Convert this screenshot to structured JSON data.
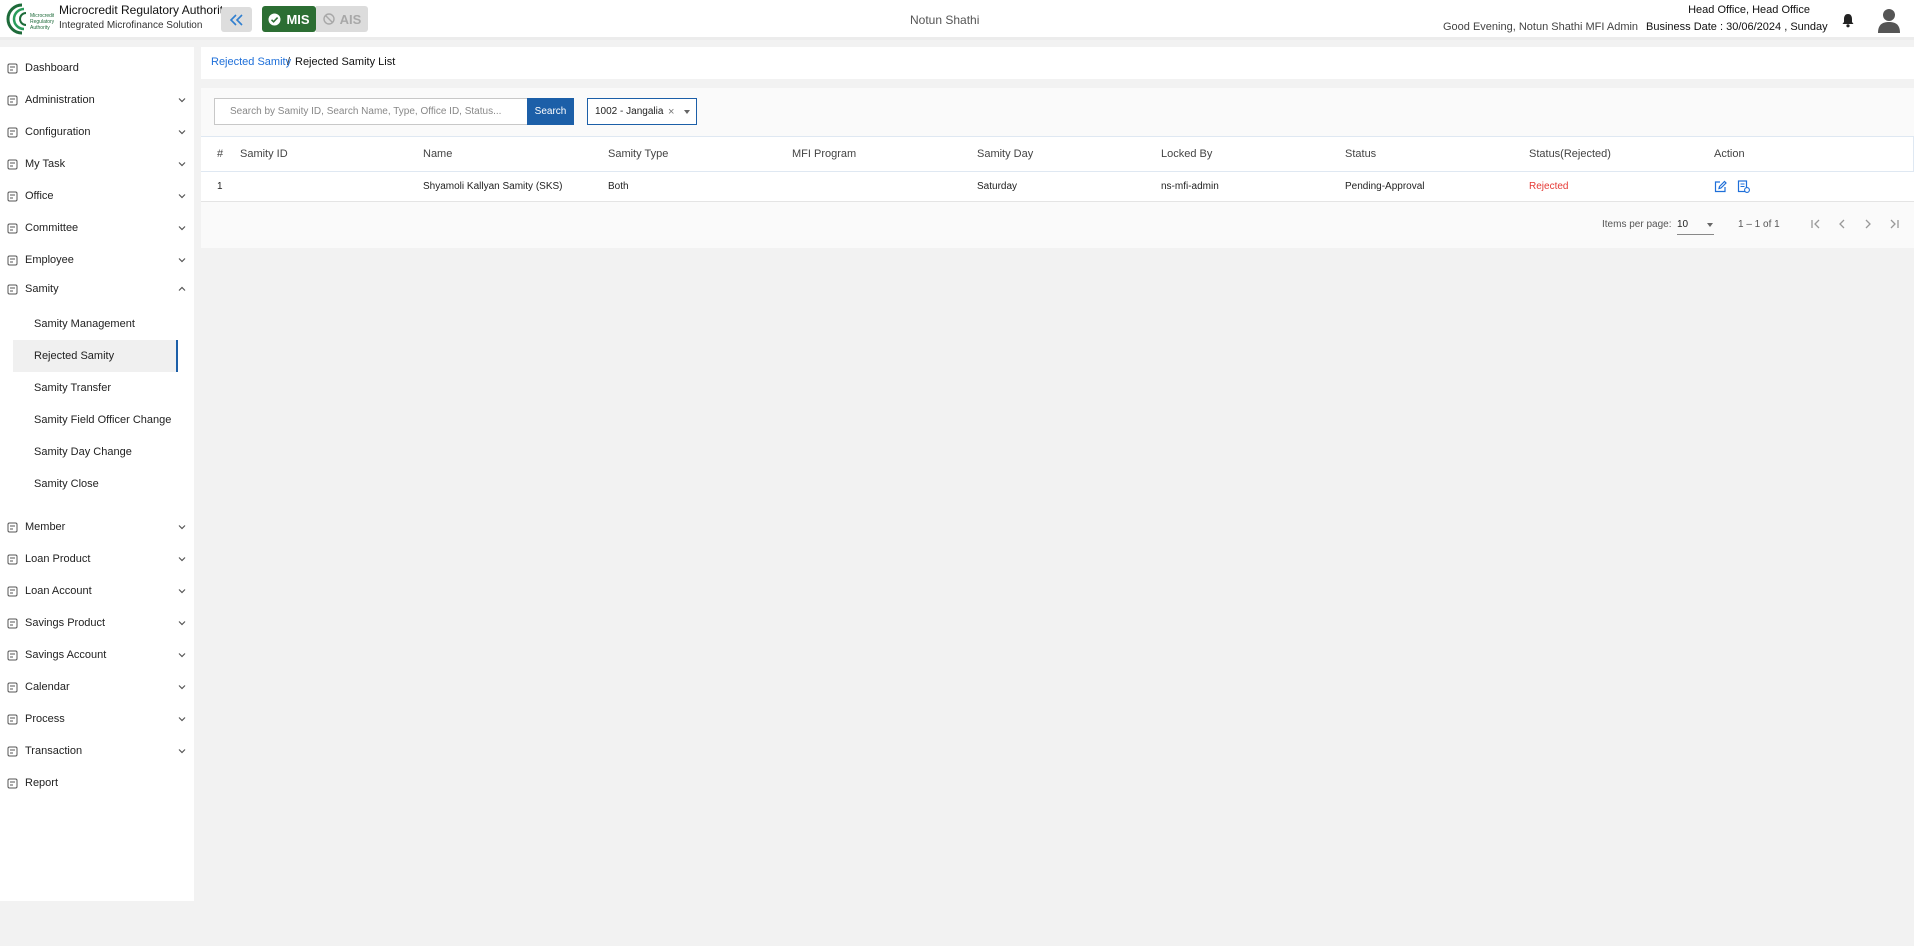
{
  "header": {
    "logo_text": "Microcredit Regulatory Authority",
    "brand_title": "Microcredit Regulatory Authority",
    "brand_subtitle": "Integrated Microfinance Solution",
    "mis_label": "MIS",
    "ais_label": "AIS",
    "center_title": "Notun Shathi",
    "greeting": "Good Evening, Notun Shathi MFI Admin",
    "office": "Head Office, Head Office",
    "business_date": "Business Date : 30/06/2024 , Sunday",
    "icons": {
      "collapse": "double-chevron-left-icon",
      "mis": "check-circle-icon",
      "ais": "ban-icon",
      "bell": "bell-icon",
      "avatar": "user-avatar-icon"
    }
  },
  "sidebar": {
    "items": [
      {
        "label": "Dashboard",
        "icon": "dashboard-icon"
      },
      {
        "label": "Administration",
        "icon": "admin-icon"
      },
      {
        "label": "Configuration",
        "icon": "sliders-icon"
      },
      {
        "label": "My Task",
        "icon": "task-icon"
      },
      {
        "label": "Office",
        "icon": "office-icon"
      },
      {
        "label": "Committee",
        "icon": "committee-icon"
      },
      {
        "label": "Employee",
        "icon": "employee-icon"
      },
      {
        "label": "Samity",
        "icon": "samity-icon"
      },
      {
        "label": "Member",
        "icon": "member-icon"
      },
      {
        "label": "Loan Product",
        "icon": "loan-product-icon"
      },
      {
        "label": "Loan Account",
        "icon": "loan-account-icon"
      },
      {
        "label": "Savings Product",
        "icon": "savings-product-icon"
      },
      {
        "label": "Savings Account",
        "icon": "savings-account-icon"
      },
      {
        "label": "Calendar",
        "icon": "calendar-icon"
      },
      {
        "label": "Process",
        "icon": "process-icon"
      },
      {
        "label": "Transaction",
        "icon": "transaction-icon"
      },
      {
        "label": "Report",
        "icon": "report-icon"
      }
    ],
    "samity_sub": [
      {
        "label": "Samity Management"
      },
      {
        "label": "Rejected Samity"
      },
      {
        "label": "Samity Transfer"
      },
      {
        "label": "Samity Field Officer Change"
      },
      {
        "label": "Samity Day Change"
      },
      {
        "label": "Samity Close"
      }
    ]
  },
  "breadcrumb": {
    "parent": "Rejected Samity",
    "separator": "/",
    "current": "Rejected Samity List"
  },
  "search": {
    "placeholder": "Search by Samity ID, Search Name, Type, Office ID, Status...",
    "button": "Search"
  },
  "office_filter": {
    "value": "1002 - Jangalia",
    "clear": "×"
  },
  "table": {
    "columns": [
      "#",
      "Samity ID",
      "Name",
      "Samity Type",
      "MFI Program",
      "Samity Day",
      "Locked By",
      "Status",
      "Status(Rejected)",
      "Action"
    ],
    "rows": [
      {
        "index": "1",
        "samity_id": "",
        "name": "Shyamoli Kallyan Samity (SKS)",
        "type": "Both",
        "program": "",
        "day": "Saturday",
        "locked_by": "ns-mfi-admin",
        "status": "Pending-Approval",
        "status_rejected": "Rejected"
      }
    ],
    "action_icons": [
      "edit-icon",
      "document-settings-icon"
    ]
  },
  "paginator": {
    "items_per_page_label": "Items per page:",
    "items_per_page": "10",
    "range": "1 – 1 of 1"
  },
  "colors": {
    "primary": "#1c5fa8",
    "mis_green": "#2c6e33",
    "rejected_red": "#e53935",
    "link_blue": "#1e6fd9"
  }
}
